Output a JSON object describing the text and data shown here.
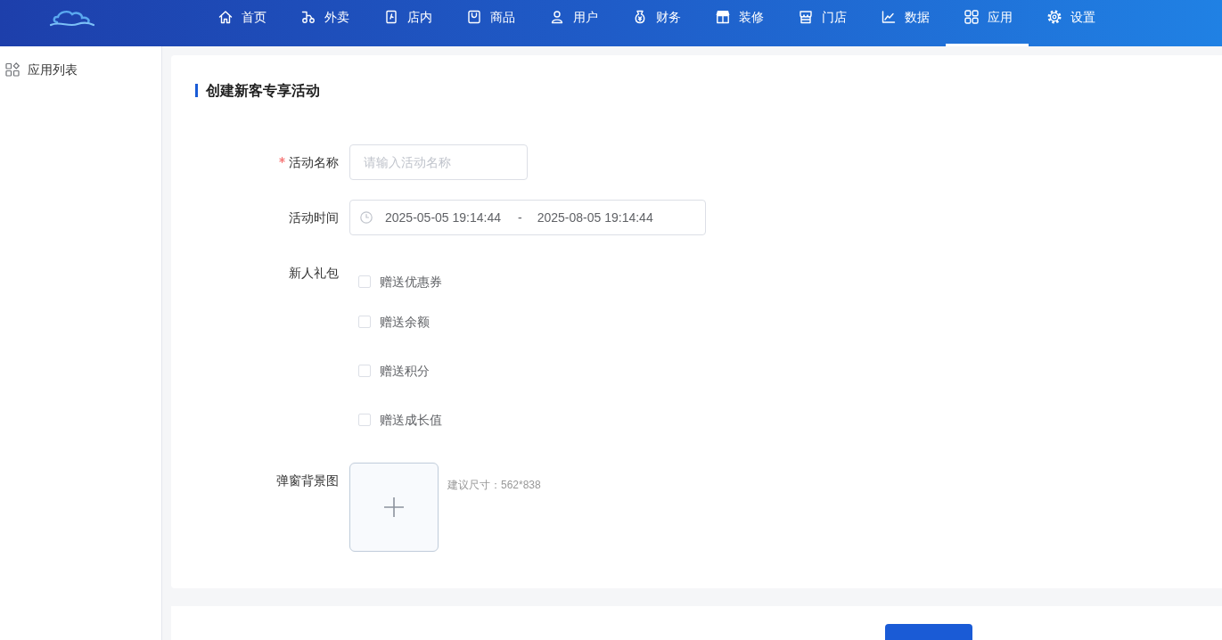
{
  "header": {
    "nav": [
      {
        "label": "首页",
        "selected": false
      },
      {
        "label": "外卖",
        "selected": false
      },
      {
        "label": "店内",
        "selected": false
      },
      {
        "label": "商品",
        "selected": false
      },
      {
        "label": "用户",
        "selected": false
      },
      {
        "label": "财务",
        "selected": false
      },
      {
        "label": "装修",
        "selected": false
      },
      {
        "label": "门店",
        "selected": false
      },
      {
        "label": "数据",
        "selected": false
      },
      {
        "label": "应用",
        "selected": true
      },
      {
        "label": "设置",
        "selected": false
      }
    ]
  },
  "sidebar": {
    "items": [
      {
        "label": "应用列表"
      }
    ]
  },
  "form": {
    "title": "创建新客专享活动",
    "fields": [
      {
        "kind": "text",
        "label": "活动名称",
        "required": true,
        "placeholder": "请输入活动名称"
      },
      {
        "kind": "daterange",
        "label": "活动时间",
        "required": false,
        "start": "2025-05-05 19:14:44",
        "separator": "-",
        "end": "2025-08-05 19:14:44"
      },
      {
        "kind": "checkboxes",
        "label": "新人礼包",
        "required": false,
        "options": [
          {
            "label": "赠送优惠券",
            "checked": false
          },
          {
            "label": "赠送余额",
            "checked": false
          },
          {
            "label": "赠送积分",
            "checked": false
          },
          {
            "label": "赠送成长值",
            "checked": false
          }
        ]
      },
      {
        "kind": "upload",
        "label": "弹窗背景图",
        "required": false,
        "hint": "建议尺寸：562*838"
      }
    ]
  },
  "footer": {
    "buttons": [
      {
        "kind": "primary"
      }
    ]
  }
}
